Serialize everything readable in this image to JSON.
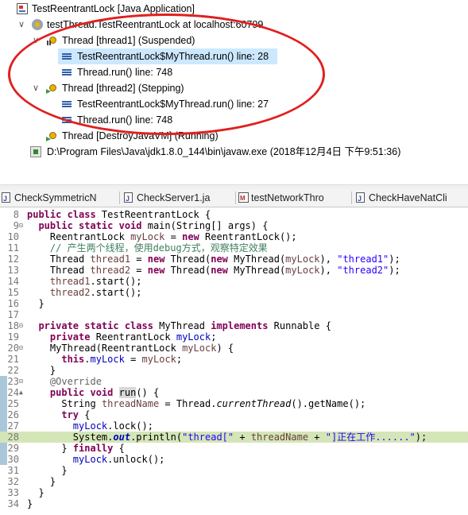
{
  "debug_tree": {
    "app": "TestReentrantLock [Java Application]",
    "vm": "testThread.TestReentrantLock at localhost:60799",
    "thread1": "Thread [thread1] (Suspended)",
    "thread1_frames": [
      "TestReentrantLock$MyThread.run() line: 28",
      "Thread.run() line: 748"
    ],
    "thread2": "Thread [thread2] (Stepping)",
    "thread2_frames": [
      "TestReentrantLock$MyThread.run() line: 27",
      "Thread.run() line: 748"
    ],
    "thread3": "Thread [DestroyJavaVM] (Running)",
    "process": "D:\\Program Files\\Java\\jdk1.8.0_144\\bin\\javaw.exe (2018年12月4日 下午9:51:36)"
  },
  "tabs": [
    "CheckSymmetricN",
    "CheckServer1.ja",
    "testNetworkThro",
    "CheckHaveNatCli"
  ],
  "editor": {
    "line_numbers": [
      "8",
      "9",
      "10",
      "11",
      "12",
      "13",
      "14",
      "15",
      "16",
      "17",
      "18",
      "19",
      "20",
      "21",
      "22",
      "23",
      "24",
      "25",
      "26",
      "27",
      "28",
      "29",
      "30",
      "31",
      "32",
      "33",
      "34"
    ],
    "highlighted_line": "28",
    "code": {
      "l8_kw": "public class",
      "l8_rest": " TestReentrantLock {",
      "l9_kw": "public static void",
      "l9_rest": " main(String[] args) {",
      "l10_a": "ReentrantLock ",
      "l10_var": "myLock",
      "l10_eq": " = ",
      "l10_new": "new",
      "l10_b": " ReentrantLock();",
      "l11_cm": "// 产生两个线程，使用debug方式，观察特定效果",
      "l12_a": "Thread ",
      "l12_var": "thread1",
      "l12_eq": " = ",
      "l12_new": "new",
      "l12_b": " Thread(",
      "l12_new2": "new",
      "l12_c": " MyThread(",
      "l12_var2": "myLock",
      "l12_d": "), ",
      "l12_str": "\"thread1\"",
      "l12_e": ");",
      "l13_a": "Thread ",
      "l13_var": "thread2",
      "l13_eq": " = ",
      "l13_new": "new",
      "l13_b": " Thread(",
      "l13_new2": "new",
      "l13_c": " MyThread(",
      "l13_var2": "myLock",
      "l13_d": "), ",
      "l13_str": "\"thread2\"",
      "l13_e": ");",
      "l14_var": "thread1",
      "l14_rest": ".start();",
      "l15_var": "thread2",
      "l15_rest": ".start();",
      "l16": "}",
      "l18_kw": "private static class",
      "l18_a": " MyThread ",
      "l18_kw2": "implements",
      "l18_b": " Runnable {",
      "l19_kw": "private",
      "l19_a": " ReentrantLock ",
      "l19_fld": "myLock",
      "l19_b": ";",
      "l20_a": "MyThread(ReentrantLock ",
      "l20_var": "myLock",
      "l20_b": ") {",
      "l21_kw": "this",
      "l21_a": ".",
      "l21_fld": "myLock",
      "l21_b": " = ",
      "l21_var": "myLock",
      "l21_c": ";",
      "l22": "}",
      "l23_an": "@Override",
      "l24_kw": "public void",
      "l24_sp": " ",
      "l24_run": "run",
      "l24_b": "() {",
      "l25_a": "String ",
      "l25_var": "threadName",
      "l25_b": " = Thread.",
      "l25_it": "currentThread",
      "l25_c": "().getName();",
      "l26_kw": "try",
      "l26_b": " {",
      "l27_fld": "myLock",
      "l27_b": ".lock();",
      "l28_a": "System.",
      "l28_sf": "out",
      "l28_b": ".println(",
      "l28_str": "\"thread[\"",
      "l28_c": " + ",
      "l28_var": "threadName",
      "l28_d": " + ",
      "l28_str2": "\"]正在工作......\"",
      "l28_e": ");",
      "l29_a": "} ",
      "l29_kw": "finally",
      "l29_b": " {",
      "l30_fld": "myLock",
      "l30_b": ".unlock();",
      "l31": "}",
      "l32": "}",
      "l33": "}",
      "l34": "}"
    }
  },
  "colors": {
    "keyword": "#7f0055",
    "string": "#2a00ff",
    "comment": "#3f7f5f",
    "field": "#0000c0",
    "current_line": "#d4e6b8",
    "selection": "#cce8ff",
    "annotation_ring": "#e02020"
  }
}
